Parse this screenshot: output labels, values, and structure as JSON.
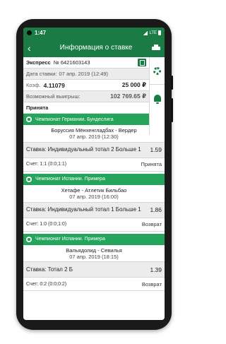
{
  "status_bar": {
    "time": "1:47",
    "network": "LTE"
  },
  "appbar": {
    "title": "Информация о ставке"
  },
  "ticket": {
    "express_label": "Экспресс",
    "express_no": "№ 6421603143",
    "date_label": "Дата ставки:",
    "date_value": "07 апр. 2019 (12:49)",
    "coef_label": "Коэф.",
    "coef_value": "4.11079",
    "stake_value": "25 000 ₽",
    "win_label": "Возможный выигрыш:",
    "win_value": "102 769.65 ₽",
    "status": "Принята"
  },
  "events": [
    {
      "league": "Чемпионат Германии. Бундеслига",
      "match": "Боруссия Мёнхенгладбах - Вердер",
      "date": "07 апр. 2019 (12:30)",
      "bet": "Ставка: Индивидуальный тотал 2 Больше 1",
      "odds": "1.59",
      "score": "Счет: 1:1 (0:0;1:1)",
      "status": "Принята"
    },
    {
      "league": "Чемпионат Испании. Примера",
      "match": "Хетафе - Атлетик Бильбао",
      "date": "07 апр. 2019 (16:00)",
      "bet": "Ставка: Индивидуальный тотал 1 Больше 1",
      "odds": "1.86",
      "score": "Счет: 1:0 (0:0;1:0)",
      "status": "Возврат"
    },
    {
      "league": "Чемпионат Испании. Примера",
      "match": "Вальядолид - Севилья",
      "date": "07 апр. 2019 (18:15)",
      "bet": "Ставка: Тотал 2 Б",
      "odds": "1.39",
      "score": "Счет: 0:2 (0:0;0:2)",
      "status": "Возврат"
    }
  ],
  "colors": {
    "primary": "#1b7b45",
    "league_bar": "#25a55c",
    "row_grey": "#ececec"
  }
}
